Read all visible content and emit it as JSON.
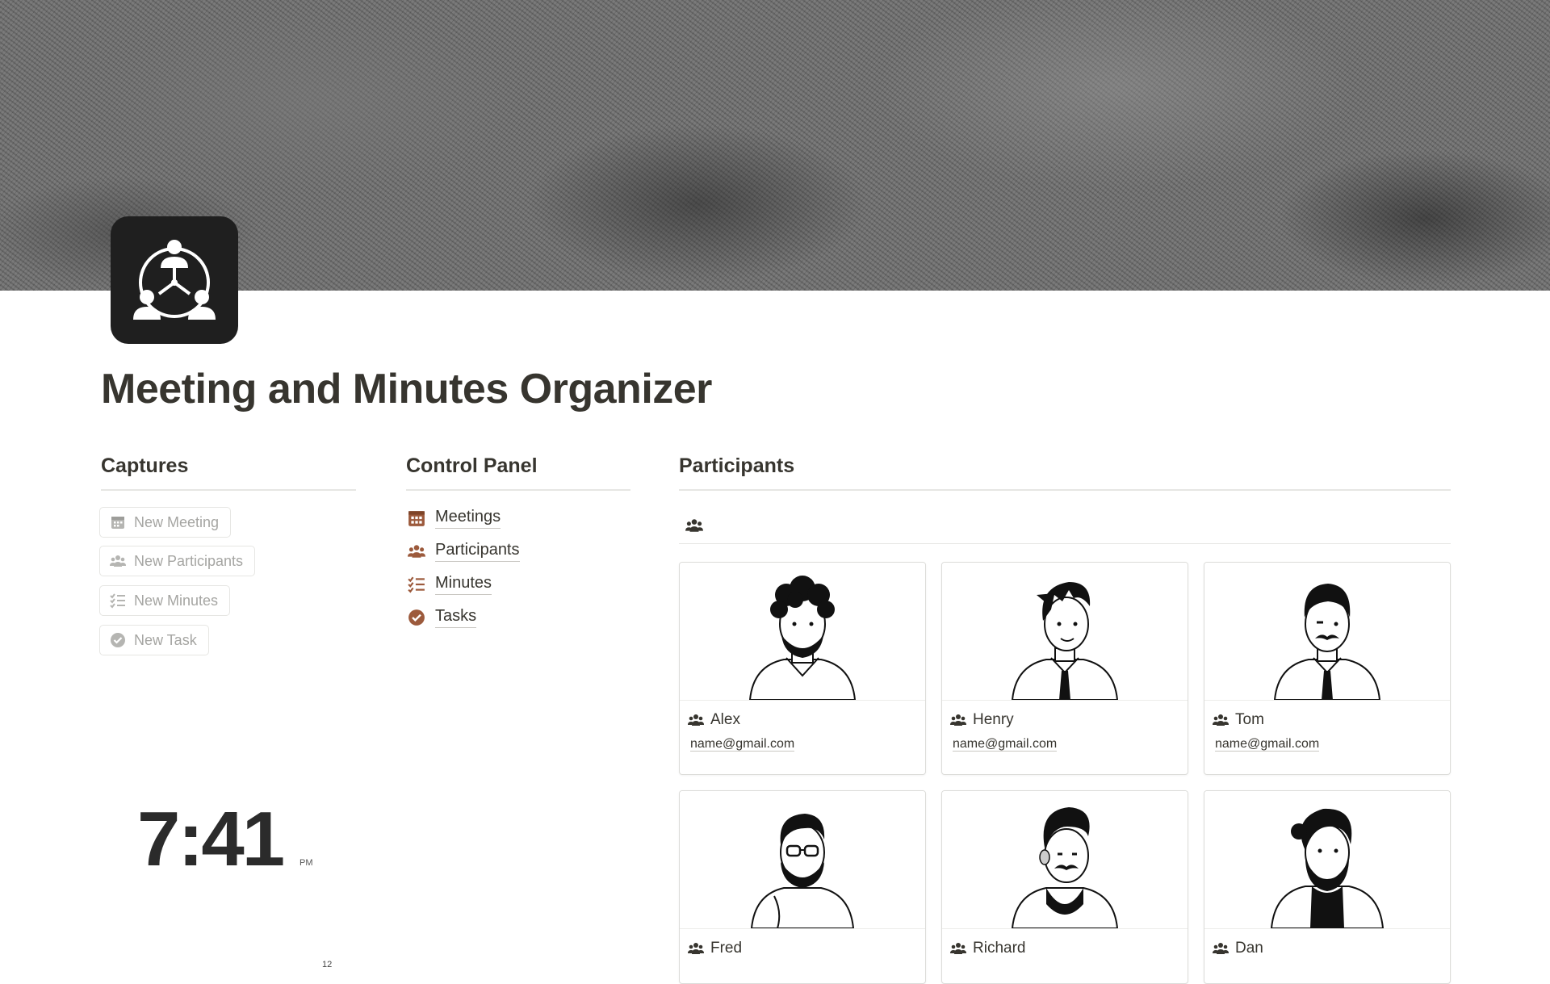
{
  "page": {
    "title": "Meeting and Minutes Organizer",
    "icon": "meeting-network-icon"
  },
  "captures": {
    "heading": "Captures",
    "buttons": [
      {
        "label": "New Meeting",
        "icon": "calendar-icon"
      },
      {
        "label": "New Participants",
        "icon": "people-icon"
      },
      {
        "label": "New Minutes",
        "icon": "checklist-icon"
      },
      {
        "label": "New Task",
        "icon": "check-circle-icon"
      }
    ]
  },
  "control_panel": {
    "heading": "Control Panel",
    "accent": "#9c5a3c",
    "items": [
      {
        "label": "Meetings",
        "icon": "calendar-icon"
      },
      {
        "label": "Participants",
        "icon": "people-icon"
      },
      {
        "label": "Minutes",
        "icon": "checklist-icon"
      },
      {
        "label": "Tasks",
        "icon": "check-circle-icon"
      }
    ]
  },
  "participants": {
    "heading": "Participants",
    "view_icon": "people-icon",
    "cards": [
      {
        "name": "Alex",
        "email": "name@gmail.com",
        "avatar": "curly-hair-beard-avatar"
      },
      {
        "name": "Henry",
        "email": "name@gmail.com",
        "avatar": "spiky-hair-tie-avatar"
      },
      {
        "name": "Tom",
        "email": "name@gmail.com",
        "avatar": "mustache-tie-avatar"
      },
      {
        "name": "Fred",
        "email": "",
        "avatar": "glasses-beard-avatar"
      },
      {
        "name": "Richard",
        "email": "",
        "avatar": "pompadour-mustache-avatar"
      },
      {
        "name": "Dan",
        "email": "",
        "avatar": "beard-jacket-avatar"
      }
    ]
  },
  "clock": {
    "time": "7:41",
    "ampm": "PM",
    "date_fragment": "12"
  }
}
